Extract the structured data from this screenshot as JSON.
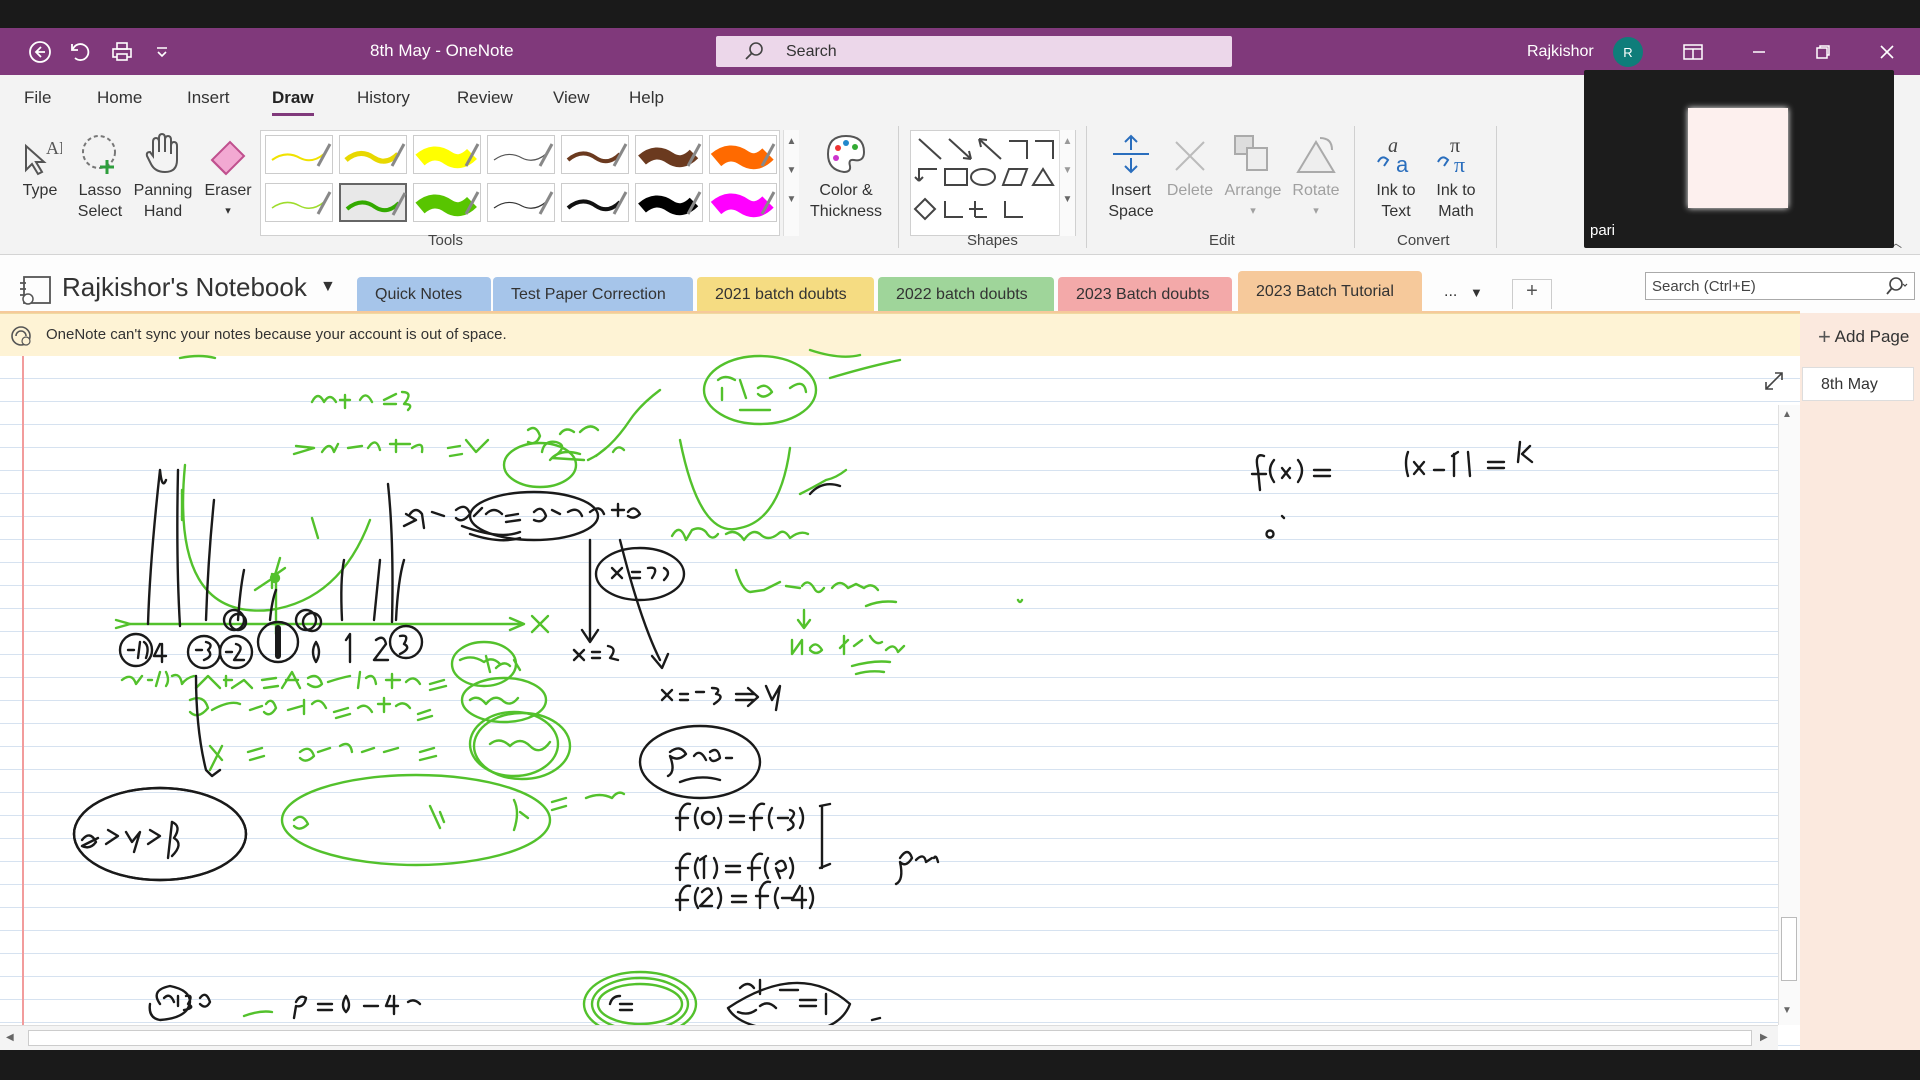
{
  "titlebar": {
    "title": "8th May  -  OneNote",
    "search_placeholder": "Search",
    "user_name": "Rajkishor",
    "avatar_initial": "R",
    "accent_color": "#80397b"
  },
  "menu": {
    "items": [
      "File",
      "Home",
      "Insert",
      "Draw",
      "History",
      "Review",
      "View",
      "Help"
    ],
    "active": "Draw"
  },
  "ribbon": {
    "type": {
      "label1": "Type",
      "label2": ""
    },
    "lasso": {
      "label1": "Lasso",
      "label2": "Select"
    },
    "panning": {
      "label1": "Panning",
      "label2": "Hand"
    },
    "eraser": {
      "label1": "Eraser",
      "label2": ""
    },
    "color_thickness": {
      "label1": "Color &",
      "label2": "Thickness"
    },
    "tools_group": "Tools",
    "shapes_group": "Shapes",
    "insert_space": {
      "label1": "Insert",
      "label2": "Space"
    },
    "delete": "Delete",
    "arrange": "Arrange",
    "rotate": "Rotate",
    "edit_group": "Edit",
    "ink_to_text": {
      "label1": "Ink to",
      "label2": "Text"
    },
    "ink_to_math": {
      "label1": "Ink to",
      "label2": "Math"
    },
    "convert_group": "Convert",
    "pen_colors": [
      "#f0e200",
      "#e8d800",
      "#ffff00",
      "#555555",
      "#6b3a1f",
      "#6b3a1f",
      "#ff6a00",
      "#9edc2c",
      "#33aa00",
      "#58c500",
      "#333333",
      "#111111",
      "#000000",
      "#ff00ff"
    ]
  },
  "notebook": {
    "title": "Rajkishor's Notebook",
    "tabs": [
      {
        "label": "Quick Notes",
        "color": "#a6c5ea"
      },
      {
        "label": "Test Paper Correction",
        "color": "#a6c5ea"
      },
      {
        "label": "2021 batch doubts",
        "color": "#f5dc82"
      },
      {
        "label": "2022 batch doubts",
        "color": "#9fd59a"
      },
      {
        "label": "2023 Batch doubts",
        "color": "#f3a9a9"
      },
      {
        "label": "2023 Batch Tutorial",
        "color": "#f6c99b"
      }
    ],
    "more_tabs": "...",
    "add_tab": "+",
    "search_placeholder": "Search (Ctrl+E)"
  },
  "warning": {
    "text": "OneNote can't sync your notes because your account is out of space."
  },
  "pages": {
    "add_page": "Add Page",
    "items": [
      "8th May"
    ]
  },
  "video": {
    "participant": "pari"
  }
}
